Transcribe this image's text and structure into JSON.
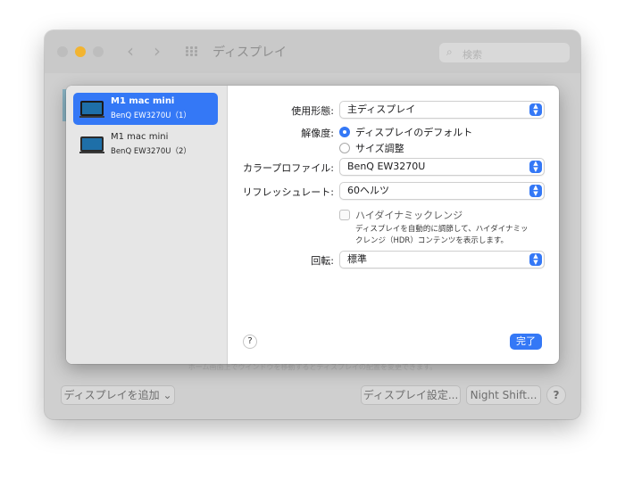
{
  "window": {
    "title": "ディスプレイ",
    "search_placeholder": "検索",
    "bottom_hint": "ホーム画面上でウインドウを移動するとディスプレイの配置を変更できます。",
    "add_display_label": "ディスプレイを追加",
    "display_settings_label": "ディスプレイ設定...",
    "night_shift_label": "Night Shift...",
    "help_label": "?"
  },
  "sidebar": {
    "items": [
      {
        "name": "M1 mac mini",
        "subtitle": "BenQ EW3270U（1）",
        "selected": true
      },
      {
        "name": "M1 mac mini",
        "subtitle": "BenQ EW3270U（2）",
        "selected": false
      }
    ]
  },
  "settings": {
    "usage_label": "使用形態:",
    "usage_value": "主ディスプレイ",
    "resolution_label": "解像度:",
    "resolution_options": [
      "ディスプレイのデフォルト",
      "サイズ調整"
    ],
    "resolution_selected": 0,
    "color_profile_label": "カラープロファイル:",
    "color_profile_value": "BenQ EW3270U",
    "refresh_label": "リフレッシュレート:",
    "refresh_value": "60ヘルツ",
    "hdr_label": "ハイダイナミックレンジ",
    "hdr_checked": false,
    "hdr_hint_line1": "ディスプレイを自動的に調節して、ハイダイナミッ",
    "hdr_hint_line2": "クレンジ（HDR）コンテンツを表示します。",
    "rotation_label": "回転:",
    "rotation_value": "標準"
  },
  "sheet": {
    "help_label": "?",
    "done_label": "完了"
  },
  "colors": {
    "accent": "#3478f6",
    "minimize": "#f2b431"
  }
}
